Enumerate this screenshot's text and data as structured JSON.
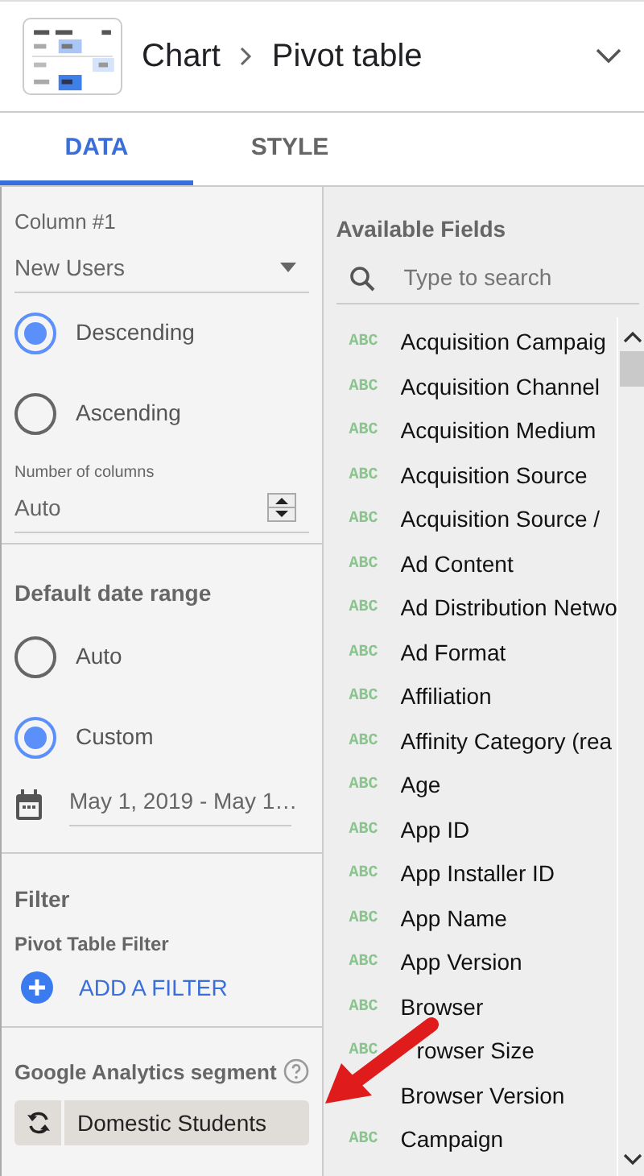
{
  "header": {
    "parent": "Chart",
    "title": "Pivot table"
  },
  "tabs": [
    {
      "label": "DATA",
      "selected": true
    },
    {
      "label": "STYLE",
      "selected": false
    }
  ],
  "sort": {
    "label": "Column #1",
    "value": "New Users",
    "options": [
      {
        "label": "Descending",
        "selected": true
      },
      {
        "label": "Ascending",
        "selected": false
      }
    ]
  },
  "columns_count": {
    "label": "Number of columns",
    "value": "Auto"
  },
  "date_range": {
    "heading": "Default date range",
    "options": [
      {
        "label": "Auto",
        "selected": false
      },
      {
        "label": "Custom",
        "selected": true
      }
    ],
    "value": "May 1, 2019 - May 1…"
  },
  "filter": {
    "heading": "Filter",
    "subheading": "Pivot Table Filter",
    "button": "ADD A FILTER"
  },
  "segment": {
    "heading": "Google Analytics segment",
    "value": "Domestic Students"
  },
  "fields": {
    "heading": "Available Fields",
    "placeholder": "Type to search",
    "items": [
      {
        "type": "ABC",
        "name": "Acquisition Campaig"
      },
      {
        "type": "ABC",
        "name": "Acquisition Channel"
      },
      {
        "type": "ABC",
        "name": "Acquisition Medium"
      },
      {
        "type": "ABC",
        "name": "Acquisition Source"
      },
      {
        "type": "ABC",
        "name": "Acquisition Source /"
      },
      {
        "type": "ABC",
        "name": "Ad Content"
      },
      {
        "type": "ABC",
        "name": "Ad Distribution Netwo"
      },
      {
        "type": "ABC",
        "name": "Ad Format"
      },
      {
        "type": "ABC",
        "name": "Affiliation"
      },
      {
        "type": "ABC",
        "name": "Affinity Category (rea"
      },
      {
        "type": "ABC",
        "name": "Age"
      },
      {
        "type": "ABC",
        "name": "App ID"
      },
      {
        "type": "ABC",
        "name": "App Installer ID"
      },
      {
        "type": "ABC",
        "name": "App Name"
      },
      {
        "type": "ABC",
        "name": "App Version"
      },
      {
        "type": "ABC",
        "name": "Browser"
      },
      {
        "type": "ABC",
        "name": "rowser Size",
        "cut_start": true
      },
      {
        "name": "Browser Version"
      },
      {
        "type": "ABC",
        "name": "Campaign"
      }
    ]
  }
}
